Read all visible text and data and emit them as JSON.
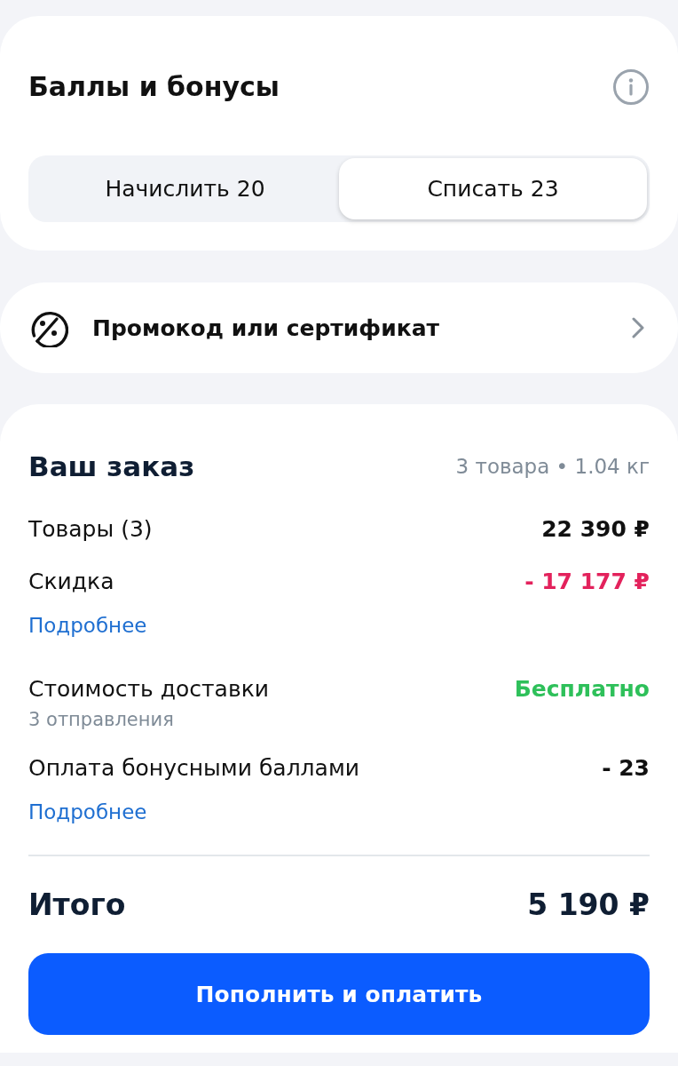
{
  "bonuses": {
    "title": "Баллы и бонусы",
    "tabs": [
      {
        "label": "Начислить 20",
        "selected": false
      },
      {
        "label": "Списать 23",
        "selected": true
      }
    ]
  },
  "promo": {
    "label": "Промокод или сертификат"
  },
  "order": {
    "title": "Ваш заказ",
    "summary": "3 товара • 1.04 кг",
    "lines": [
      {
        "kind": "plain",
        "label": "Товары (3)",
        "value": "22 390 ₽"
      },
      {
        "kind": "discount",
        "label": "Скидка",
        "value": "- 17 177 ₽",
        "link": "Подробнее"
      },
      {
        "kind": "free",
        "label": "Стоимость доставки",
        "note": "3 отправления",
        "value": "Бесплатно"
      },
      {
        "kind": "plain",
        "label": "Оплата бонусными баллами",
        "value": "- 23",
        "link": "Подробнее"
      }
    ],
    "total": {
      "label": "Итого",
      "value": "5 190 ₽"
    },
    "button": "Пополнить и оплатить"
  }
}
